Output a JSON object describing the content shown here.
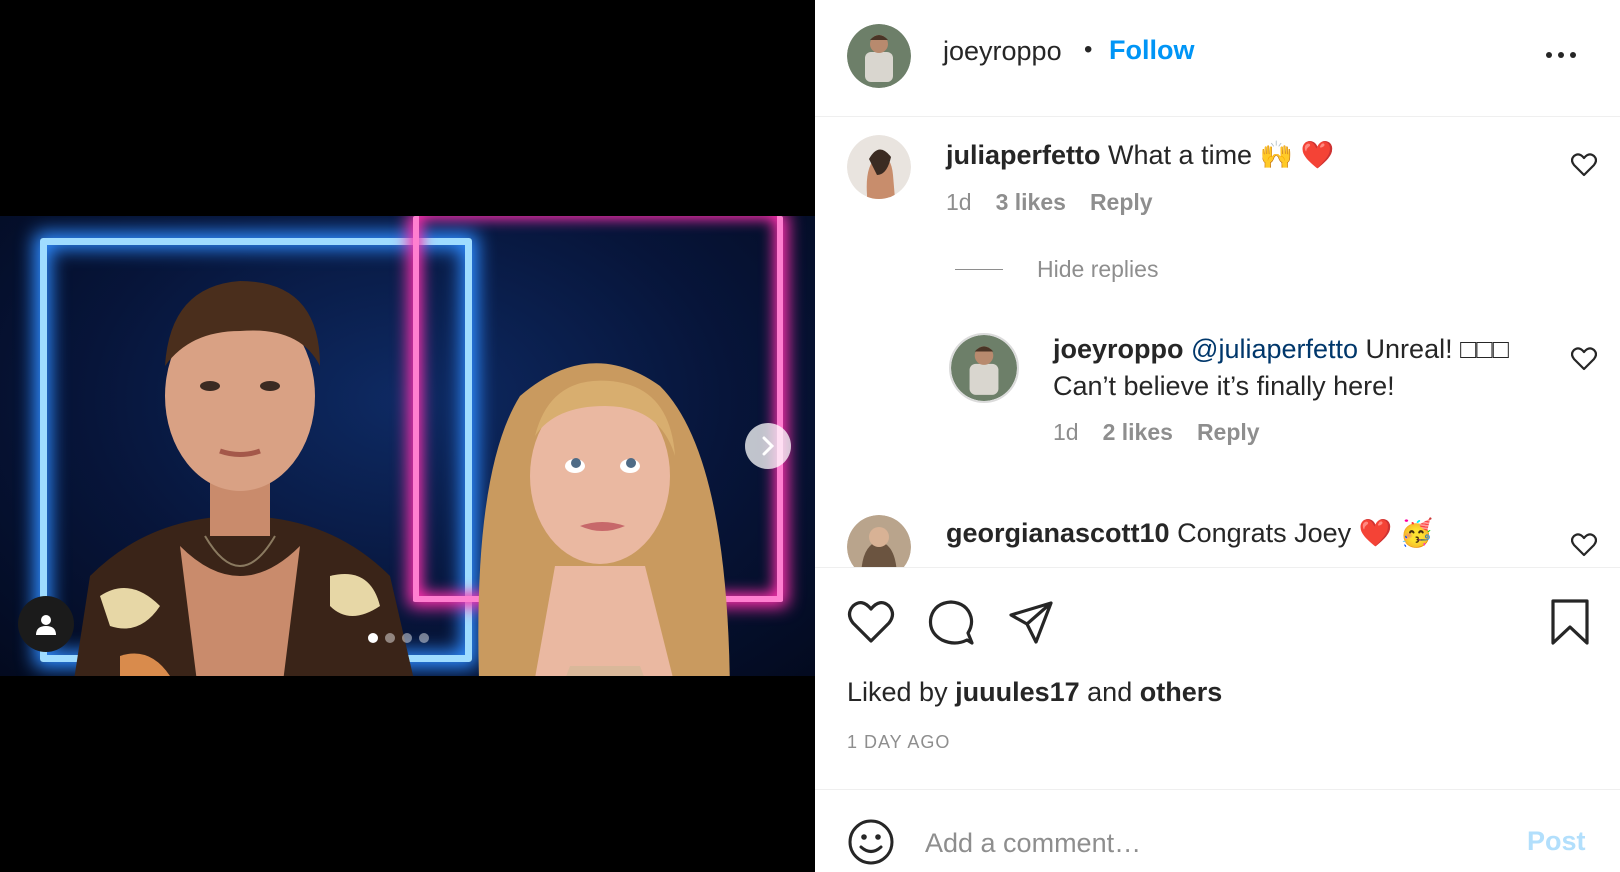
{
  "post": {
    "author": "joeyroppo",
    "bullet": "•",
    "follow_label": "Follow",
    "carousel": {
      "total_slides": 4,
      "active_slide": 1
    }
  },
  "comments": [
    {
      "user": "juliaperfetto",
      "text": "What a time",
      "emoji": "🙌 ❤️",
      "age": "1d",
      "likes": "3 likes",
      "reply_label": "Reply"
    },
    {
      "user": "joeyroppo",
      "mention": "@juliaperfetto",
      "text_line1": "Unreal! □□□",
      "text_line2": "Can’t believe it’s finally here!",
      "age": "1d",
      "likes": "2 likes",
      "reply_label": "Reply"
    },
    {
      "user": "georgianascott10",
      "text": "Congrats Joey",
      "emoji": "❤️ 🥳"
    }
  ],
  "hide_replies_label": "Hide replies",
  "liked_by": {
    "prefix": "Liked by",
    "user": "juuules17",
    "middle": "and",
    "others": "others"
  },
  "timestamp": "1 DAY AGO",
  "add_comment": {
    "placeholder": "Add a comment…",
    "post_label": "Post"
  },
  "colors": {
    "accent": "#0095f6",
    "post_disabled": "#b2dffc",
    "muted": "#8e8e8e"
  }
}
